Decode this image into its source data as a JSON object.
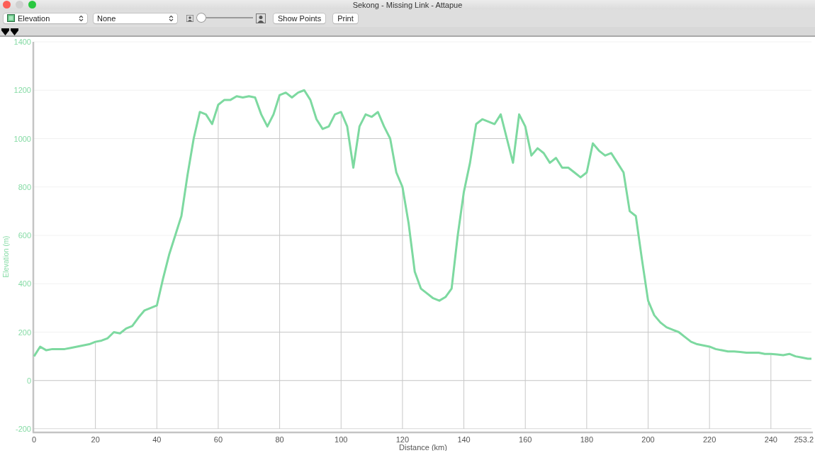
{
  "window": {
    "title": "Sekong - Missing Link - Attapue"
  },
  "toolbar": {
    "metric_select": {
      "value": "Elevation"
    },
    "overlay_select": {
      "value": "None"
    },
    "zoom_slider": {
      "level": 0
    },
    "buttons": [
      "Show Points",
      "Print"
    ]
  },
  "markers": [
    {
      "kind": "marker"
    },
    {
      "kind": "marker"
    }
  ],
  "chart": {
    "chart_data": {
      "type": "line",
      "grid": true,
      "xlabel": "Distance (km)",
      "ylabel": "Elevation (m)",
      "xlim": [
        0,
        253.2
      ],
      "ylim": [
        -200,
        1400
      ],
      "xticks": [
        0,
        20,
        40,
        60,
        80,
        100,
        120,
        140,
        160,
        180,
        200,
        220,
        240,
        253.2
      ],
      "yticks": [
        -200,
        0,
        200,
        400,
        600,
        800,
        1000,
        1200,
        1400
      ],
      "x": [
        0,
        2,
        4,
        6,
        8,
        10,
        12,
        14,
        16,
        18,
        20,
        22,
        24,
        26,
        28,
        30,
        32,
        34,
        36,
        38,
        40,
        42,
        44,
        46,
        48,
        50,
        52,
        54,
        56,
        58,
        60,
        62,
        64,
        66,
        68,
        70,
        72,
        74,
        76,
        78,
        80,
        82,
        84,
        86,
        88,
        90,
        92,
        94,
        96,
        98,
        100,
        102,
        104,
        106,
        108,
        110,
        112,
        114,
        116,
        118,
        120,
        122,
        124,
        126,
        128,
        130,
        132,
        134,
        136,
        138,
        140,
        142,
        144,
        146,
        148,
        150,
        152,
        154,
        156,
        158,
        160,
        162,
        164,
        166,
        168,
        170,
        172,
        174,
        176,
        178,
        180,
        182,
        184,
        186,
        188,
        190,
        192,
        194,
        196,
        198,
        200,
        202,
        204,
        206,
        208,
        210,
        212,
        214,
        216,
        218,
        220,
        222,
        224,
        226,
        228,
        230,
        232,
        234,
        236,
        238,
        240,
        242,
        244,
        246,
        248,
        250,
        252,
        253.2
      ],
      "series": [
        {
          "color": "#7dd9a0",
          "values": [
            100,
            140,
            125,
            130,
            130,
            130,
            135,
            140,
            145,
            150,
            160,
            165,
            175,
            200,
            195,
            215,
            225,
            260,
            290,
            300,
            310,
            420,
            520,
            600,
            680,
            850,
            1000,
            1110,
            1100,
            1060,
            1140,
            1160,
            1160,
            1175,
            1170,
            1175,
            1170,
            1100,
            1050,
            1100,
            1180,
            1190,
            1170,
            1190,
            1200,
            1160,
            1080,
            1040,
            1050,
            1100,
            1110,
            1050,
            880,
            1050,
            1100,
            1090,
            1110,
            1050,
            1000,
            860,
            800,
            650,
            450,
            380,
            360,
            340,
            330,
            345,
            380,
            600,
            780,
            900,
            1060,
            1080,
            1070,
            1060,
            1100,
            1000,
            900,
            1100,
            1050,
            930,
            960,
            940,
            900,
            920,
            880,
            880,
            860,
            840,
            860,
            980,
            950,
            930,
            940,
            900,
            860,
            700,
            680,
            500,
            330,
            270,
            240,
            220,
            210,
            200,
            180,
            160,
            150,
            145,
            140,
            130,
            125,
            120,
            120,
            118,
            115,
            115,
            115,
            110,
            110,
            108,
            105,
            110,
            100,
            95,
            90,
            90
          ]
        }
      ]
    }
  }
}
